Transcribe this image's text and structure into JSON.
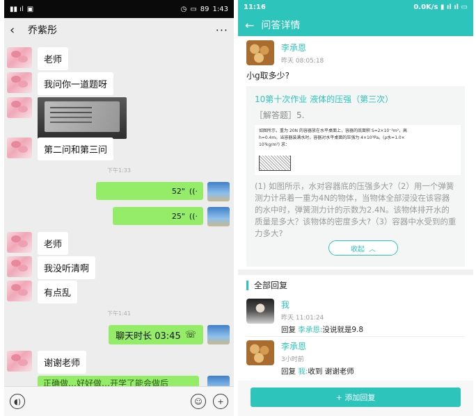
{
  "left": {
    "status": {
      "time": "1:43",
      "battery": "89"
    },
    "header": {
      "back": "‹",
      "contact": "乔紫彤",
      "more": "···"
    },
    "messages": {
      "m1": "老师",
      "m2": "我问你一道题呀",
      "m4": "第二问和第三问",
      "t1": "下午1:33",
      "v1": "52\"",
      "v2": "25\"",
      "m5": "老师",
      "m6": "我没听清啊",
      "m7": "有点乱",
      "t2": "下午1:41",
      "call": "聊天时长 03:45",
      "m8": "谢谢老师",
      "partial": "正确做…好好做…开学了能会做后"
    }
  },
  "right": {
    "status": {
      "time": "11:16",
      "speed": "0.0K/s"
    },
    "header": {
      "back": "←",
      "title": "问答详情"
    },
    "question": {
      "user": "李承恩",
      "time": "昨天 08:05:18",
      "text": "小g取多少?"
    },
    "card": {
      "title": "10第十次作业 液体的压强（第三次）",
      "tag": "［解答题］5.",
      "scan_line1": "如图所示，重为 20N 的容器放在水平桌面上，容器的底面积 S=2×10⁻²m²，高",
      "scan_line2": "h=0.4m。当容器装满水时，容器对水平桌面的压强为 4×10³Pa。(ρ水=1.0×",
      "scan_line3": "10³kg/m³) 求：",
      "body": "(1) 如图所示，水对容器底的压强多大?（2）用一个弹簧测力计吊着一重为4N的物体，当物体全部浸没在该容器的水中时，弹簧测力计的示数为2.4N。该物体排开水的质量是多大？该物体的密度多大?（3）容器中水受到的重力多大?",
      "collapse": "收起"
    },
    "replies_label": "全部回复",
    "replies": [
      {
        "user": "我",
        "time": "昨天 11:01:24",
        "prefix": "回复",
        "target": "李承恩:",
        "text": "没说就是9.8"
      },
      {
        "user": "李承恩",
        "time": "3小时前",
        "prefix": "回复",
        "target": "我:",
        "text": "收到 谢谢老师"
      }
    ],
    "add_reply": "+ 添加回复"
  }
}
